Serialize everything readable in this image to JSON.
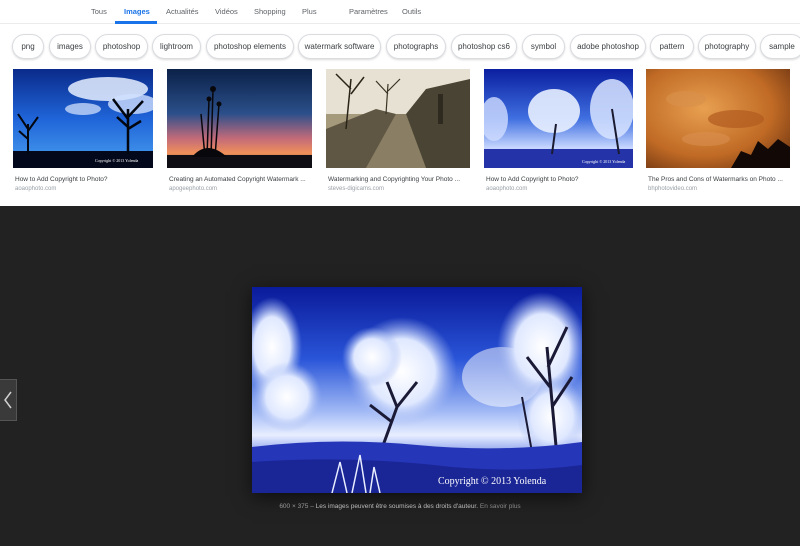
{
  "nav": {
    "tabs": [
      "Tous",
      "Images",
      "Actualités",
      "Vidéos",
      "Shopping",
      "Plus"
    ],
    "settings": "Paramètres",
    "tools": "Outils"
  },
  "chips": [
    "png",
    "images",
    "photoshop",
    "lightroom",
    "photoshop elements",
    "watermark software",
    "photographs",
    "photoshop cs6",
    "symbol",
    "adobe photoshop",
    "pattern",
    "photography",
    "sample"
  ],
  "results": [
    {
      "title": "How to Add Copyright to Photo?",
      "source": "aoaophoto.com",
      "watermark": "Copyright © 2013 Yolenda"
    },
    {
      "title": "Creating an Automated Copyright Watermark ...",
      "source": "apogeephoto.com"
    },
    {
      "title": "Watermarking and Copyrighting Your Photo ...",
      "source": "steves-digicams.com"
    },
    {
      "title": "How to Add Copyright to Photo?",
      "source": "aoaophoto.com",
      "watermark": "Copyright © 2013 Yolenda"
    },
    {
      "title": "The Pros and Cons of Watermarks on Photo ...",
      "source": "bhphotovideo.com"
    }
  ],
  "preview": {
    "watermark": "Copyright © 2013 Yolenda",
    "dimensions": "600 × 375",
    "notice": "Les images peuvent être soumises à des droits d'auteur.",
    "learn_more": "En savoir plus"
  },
  "colors": {
    "accent": "#1a73e8",
    "panel": "#222222"
  }
}
